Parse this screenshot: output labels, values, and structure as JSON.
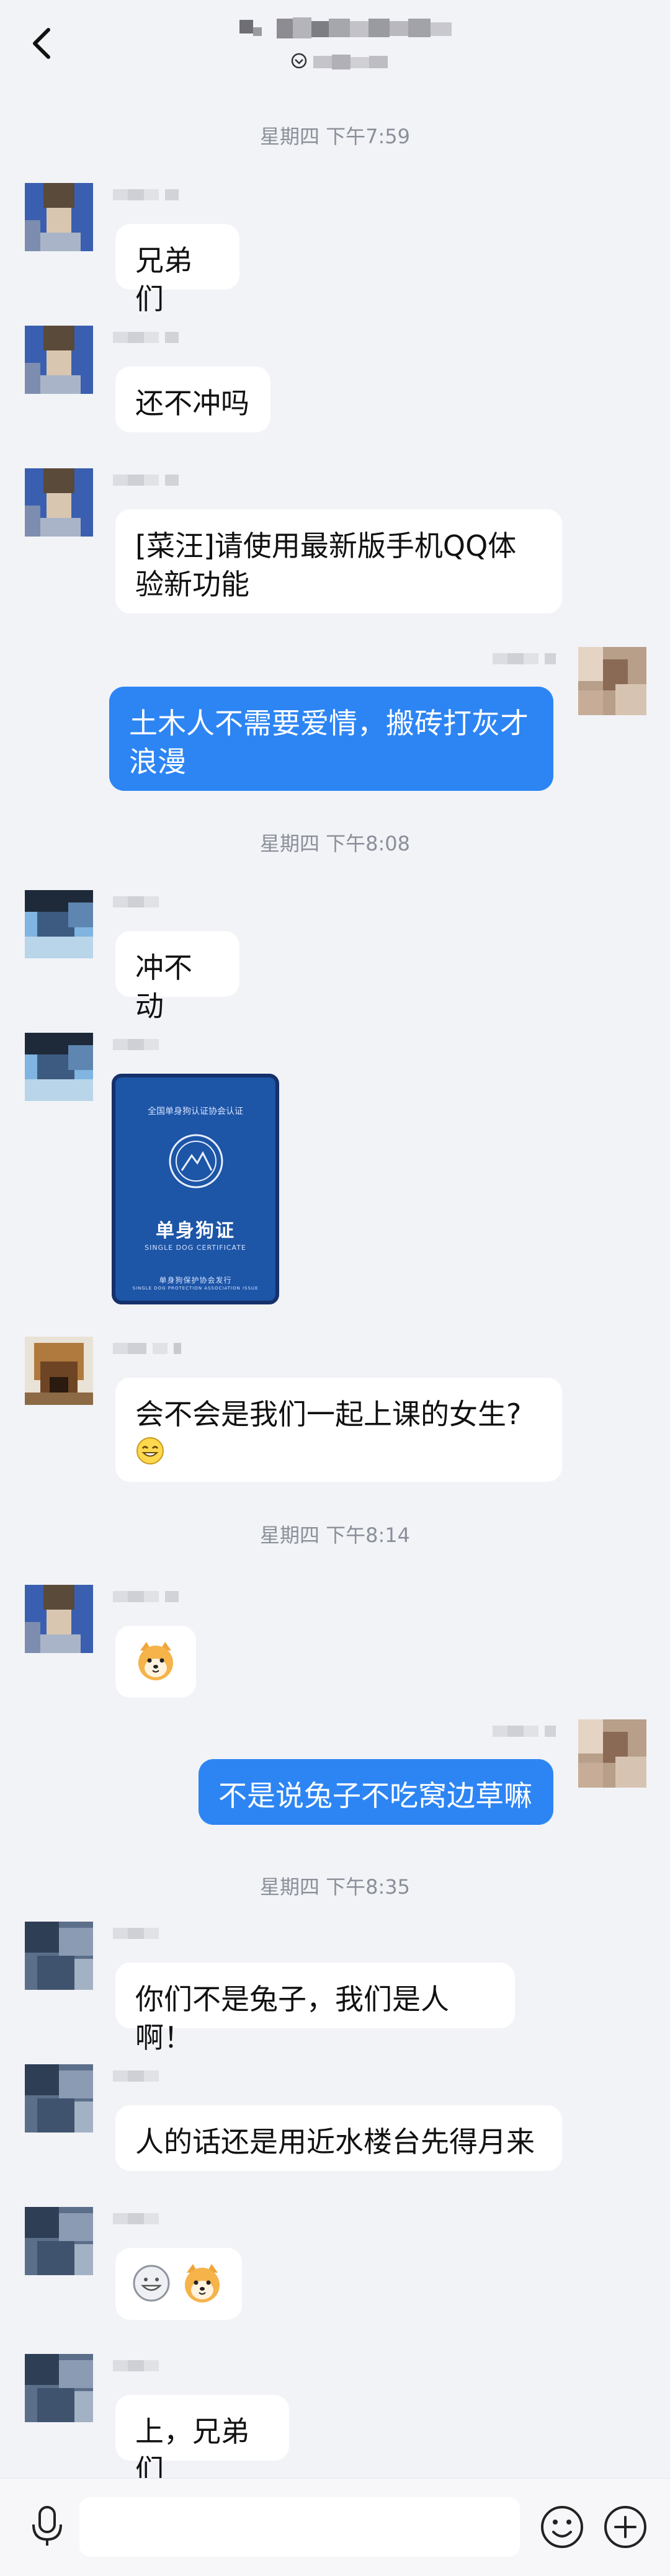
{
  "header": {
    "back_icon": "chevron-left-icon",
    "title_blurred": true,
    "subtitle_blurred": true
  },
  "timestamps": [
    "星期四 下午7:59",
    "星期四 下午8:08",
    "星期四 下午8:14",
    "星期四 下午8:35"
  ],
  "messages": {
    "m1": {
      "text": "兄弟们"
    },
    "m2": {
      "text": "还不冲吗"
    },
    "m3": {
      "text_line1": "[菜汪]请使用最新版手机QQ体",
      "text_line2": "验新功能"
    },
    "m4": {
      "text_line1": "土木人不需要爱情，搬砖打灰才",
      "text_line2": "浪漫"
    },
    "m5": {
      "text": "冲不动"
    },
    "m6": {
      "card_header": "全国单身狗认证协会认证",
      "card_title": "单身狗证",
      "card_subtitle": "SINGLE DOG CERTIFICATE",
      "card_issuer": "单身狗保护协会发行",
      "card_issuer_en": "SINGLE DOG PROTECTION ASSOCIATION ISSUE"
    },
    "m7": {
      "text": "会不会是我们一起上课的女生?"
    },
    "m8": {
      "emoji": "dog-emoji"
    },
    "m9": {
      "text": "不是说兔子不吃窝边草嘛"
    },
    "m10": {
      "text": "你们不是兔子，我们是人啊！"
    },
    "m11": {
      "text": "人的话还是用近水楼台先得月来"
    },
    "m12": {
      "emoji": "grin-dog-emoji"
    },
    "m13": {
      "text": "上，兄弟们"
    }
  },
  "bottom_bar": {
    "mic_icon": "microphone-icon",
    "input_placeholder": "",
    "emoji_icon": "smile-icon",
    "more_icon": "plus-circle-icon"
  },
  "colors": {
    "background": "#f2f3f7",
    "outgoing_bubble": "#2d85f4",
    "incoming_bubble": "#ffffff",
    "timestamp_text": "#8a8f99"
  }
}
